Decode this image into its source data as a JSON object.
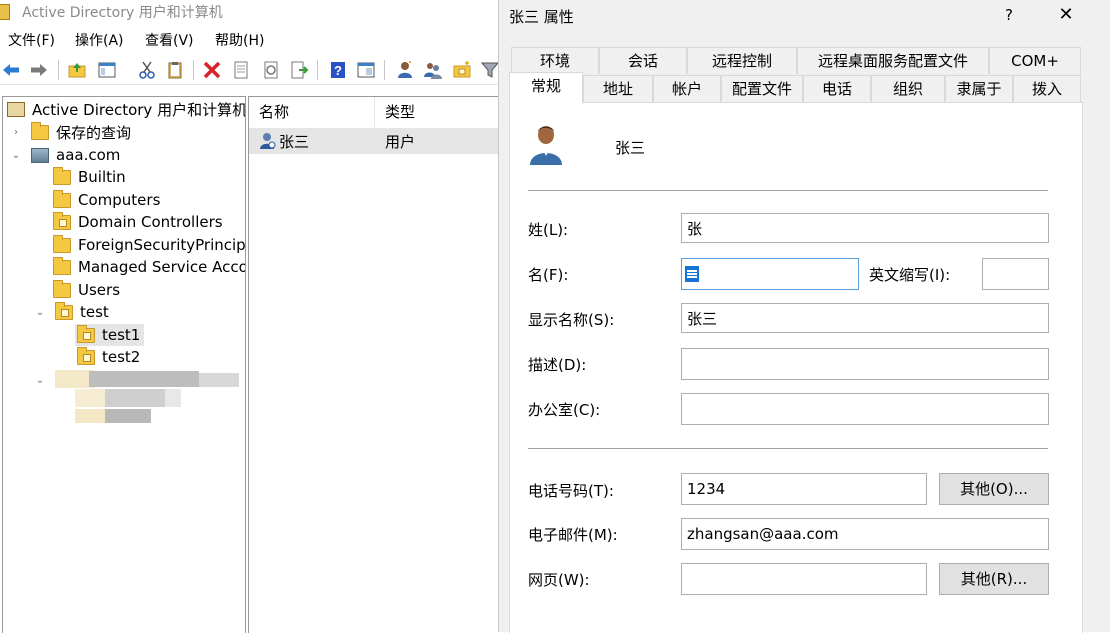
{
  "main_window": {
    "title": "Active Directory 用户和计算机",
    "menu": [
      {
        "label": "文件(F)"
      },
      {
        "label": "操作(A)"
      },
      {
        "label": "查看(V)"
      },
      {
        "label": "帮助(H)"
      }
    ],
    "toolbar_icons": [
      "back-arrow-icon",
      "forward-arrow-icon",
      "up-folder-icon",
      "show-pane-icon",
      "cut-icon",
      "clipboard-icon",
      "delete-icon",
      "properties-icon",
      "refresh-icon",
      "export-icon",
      "help-icon",
      "console-pane-icon",
      "new-user-icon",
      "new-group-icon",
      "new-ou-icon",
      "filter-icon"
    ]
  },
  "tree": {
    "root": "Active Directory 用户和计算机 [",
    "saved_queries": "保存的查询",
    "domain": "aaa.com",
    "children": [
      "Builtin",
      "Computers",
      "Domain Controllers",
      "ForeignSecurityPrincipal",
      "Managed Service Accou",
      "Users"
    ],
    "test_ou": "test",
    "test_children": [
      "test1",
      "test2"
    ]
  },
  "list": {
    "columns": [
      "名称",
      "类型"
    ],
    "rows": [
      {
        "name": "张三",
        "type": "用户"
      }
    ]
  },
  "dialog": {
    "title": "张三 属性",
    "help": "?",
    "close": "✕",
    "tabs_row1": [
      "环境",
      "会话",
      "远程控制",
      "远程桌面服务配置文件",
      "COM+"
    ],
    "tabs_row2": [
      "常规",
      "地址",
      "帐户",
      "配置文件",
      "电话",
      "组织",
      "隶属于",
      "拨入"
    ],
    "active_tab": "常规",
    "user_display": "张三",
    "fields": {
      "last_name": {
        "label": "姓(L):",
        "value": "张"
      },
      "first_name": {
        "label": "名(F):",
        "value": ""
      },
      "initials": {
        "label": "英文缩写(I):",
        "value": ""
      },
      "display_name": {
        "label": "显示名称(S):",
        "value": "张三"
      },
      "description": {
        "label": "描述(D):",
        "value": ""
      },
      "office": {
        "label": "办公室(C):",
        "value": ""
      },
      "phone": {
        "label": "电话号码(T):",
        "value": "1234"
      },
      "email": {
        "label": "电子邮件(M):",
        "value": "zhangsan@aaa.com"
      },
      "webpage": {
        "label": "网页(W):",
        "value": ""
      }
    },
    "other_phone_button": "其他(O)...",
    "other_web_button": "其他(R)..."
  }
}
